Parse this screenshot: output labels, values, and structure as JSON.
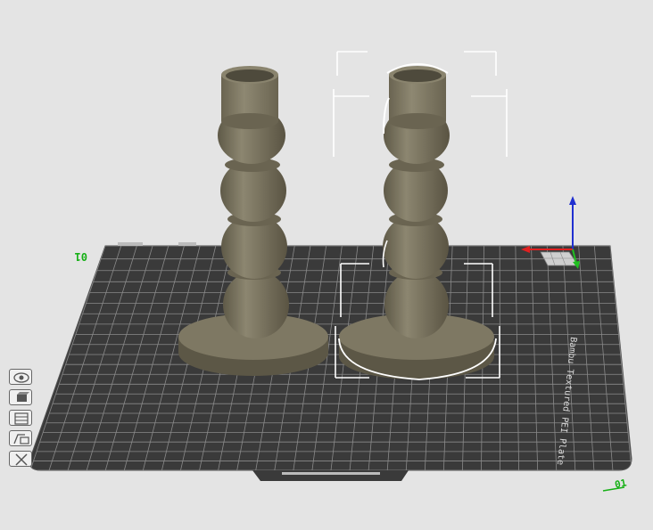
{
  "viewport": {
    "plate_name": "Bambu Textured PEI Plate",
    "plate_number": "01",
    "plate_index_label": "01",
    "objects": [
      {
        "name": "candlestick-1",
        "selected": false
      },
      {
        "name": "candlestick-2",
        "selected": true
      }
    ]
  },
  "toolbar": {
    "items": [
      {
        "name": "orient-view",
        "icon": "eye-circle-icon"
      },
      {
        "name": "arrange",
        "icon": "cube-icon"
      },
      {
        "name": "layers",
        "icon": "layers-icon"
      },
      {
        "name": "split",
        "icon": "split-icon"
      },
      {
        "name": "close",
        "icon": "close-x-icon"
      }
    ]
  },
  "colors": {
    "background": "#e4e4e4",
    "plate": "#3a3a3a",
    "grid": "#8a8a8a",
    "model": "#7a7460",
    "selection": "#ffffff",
    "axis_x": "#e02020",
    "axis_y": "#20c020",
    "axis_z": "#2030d0"
  }
}
